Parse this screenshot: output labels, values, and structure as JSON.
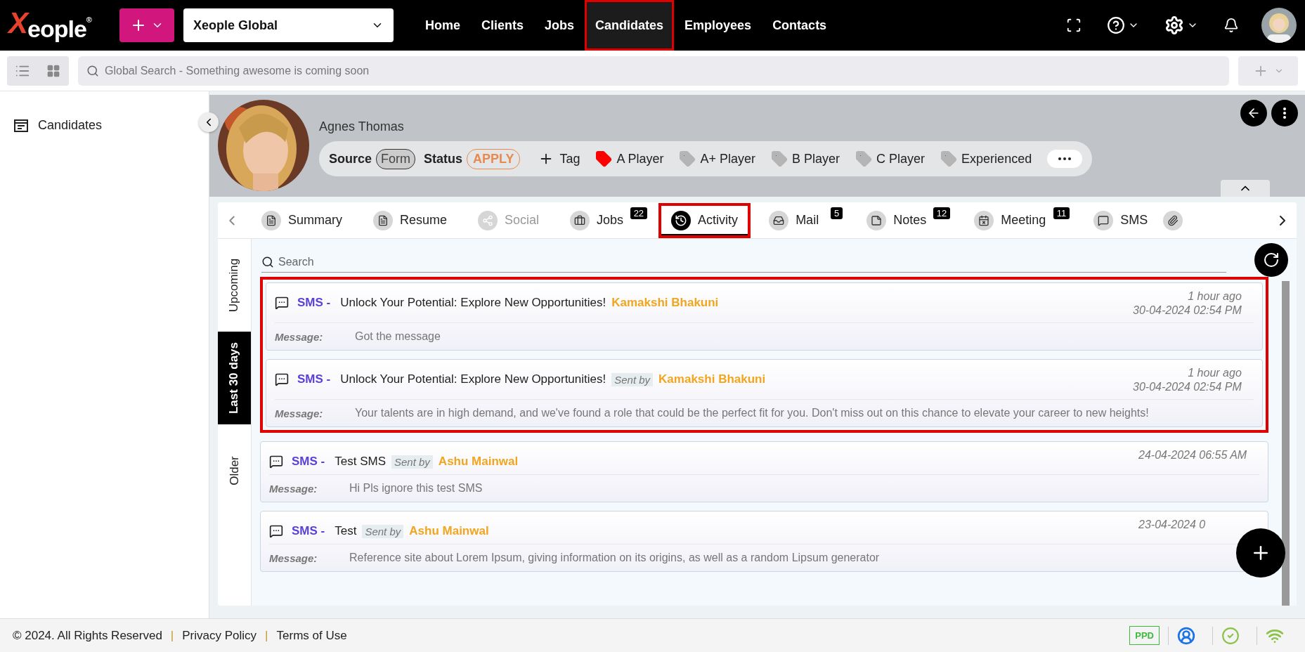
{
  "logo": {
    "text": "Xeople",
    "mark": "®"
  },
  "workspace": "Xeople Global",
  "nav": [
    {
      "label": "Home",
      "selected": false,
      "annotated": false
    },
    {
      "label": "Clients",
      "selected": false,
      "annotated": false
    },
    {
      "label": "Jobs",
      "selected": false,
      "annotated": false
    },
    {
      "label": "Candidates",
      "selected": true,
      "annotated": true
    },
    {
      "label": "Employees",
      "selected": false,
      "annotated": false
    },
    {
      "label": "Contacts",
      "selected": false,
      "annotated": false
    }
  ],
  "global_search": {
    "placeholder": "Global Search - Something awesome is coming soon"
  },
  "sidebar": {
    "items": [
      {
        "label": "Candidates"
      }
    ]
  },
  "candidate": {
    "name": "Agnes Thomas",
    "source_label": "Source",
    "source": "Form",
    "status_label": "Status",
    "status": "APPLY",
    "add_tag": "Tag",
    "tags": [
      {
        "label": "A Player",
        "color": "#ff0000"
      },
      {
        "label": "A+ Player",
        "color": "#b5b5b5"
      },
      {
        "label": "B Player",
        "color": "#b5b5b5"
      },
      {
        "label": "C Player",
        "color": "#b5b5b5"
      },
      {
        "label": "Experienced",
        "color": "#b5b5b5"
      }
    ]
  },
  "tabs": [
    {
      "kind": "summary",
      "label": "Summary",
      "selected": false,
      "disabled": false,
      "annotated": false
    },
    {
      "kind": "resume",
      "label": "Resume",
      "selected": false,
      "disabled": false,
      "annotated": false
    },
    {
      "kind": "social",
      "label": "Social",
      "selected": false,
      "disabled": true,
      "annotated": false
    },
    {
      "kind": "jobs",
      "label": "Jobs",
      "count": "22",
      "selected": false,
      "disabled": false,
      "annotated": false
    },
    {
      "kind": "activity",
      "label": "Activity",
      "selected": true,
      "disabled": false,
      "annotated": true
    },
    {
      "kind": "mail",
      "label": "Mail",
      "count": "5",
      "selected": false,
      "disabled": false,
      "annotated": false
    },
    {
      "kind": "notes",
      "label": "Notes",
      "count": "12",
      "selected": false,
      "disabled": false,
      "annotated": false
    },
    {
      "kind": "meeting",
      "label": "Meeting",
      "count": "11",
      "selected": false,
      "disabled": false,
      "annotated": false
    },
    {
      "kind": "sms",
      "label": "SMS",
      "selected": false,
      "disabled": false,
      "annotated": false
    }
  ],
  "periods": [
    {
      "label": "Upcoming",
      "selected": false
    },
    {
      "label": "Last 30 days",
      "selected": true
    },
    {
      "label": "Older",
      "selected": false
    }
  ],
  "activity_search": {
    "placeholder": "Search"
  },
  "activities": [
    {
      "type": "SMS -",
      "subject": "Unlock Your Potential: Explore New Opportunities!",
      "author": "Kamakshi Bhakuni",
      "time_ago": "1 hour ago",
      "date": "30-04-2024 02:54 PM",
      "message_label": "Message:",
      "message": "Got the message",
      "annotated": true
    },
    {
      "type": "SMS -",
      "subject": "Unlock Your Potential: Explore New Opportunities!",
      "sent_by": "Sent by",
      "author": "Kamakshi Bhakuni",
      "time_ago": "1 hour ago",
      "date": "30-04-2024 02:54 PM",
      "message_label": "Message:",
      "message": "Your talents are in high demand, and we've found a role that could be the perfect fit for you. Don't miss out on this chance to elevate your career to new heights!",
      "annotated": true
    },
    {
      "type": "SMS -",
      "subject": "Test SMS",
      "sent_by": "Sent by",
      "author": "Ashu Mainwal",
      "date": "24-04-2024 06:55 AM",
      "message_label": "Message:",
      "message": "Hi Pls ignore this test SMS",
      "annotated": false
    },
    {
      "type": "SMS -",
      "subject": "Test",
      "sent_by": "Sent by",
      "author": "Ashu Mainwal",
      "date": "23-04-2024 0",
      "message_label": "Message:",
      "message": "Reference site about Lorem Ipsum, giving information on its origins, as well as a random Lipsum generator",
      "annotated": false
    }
  ],
  "footer": {
    "copyright": "© 2024. All Rights Reserved",
    "separator": "|",
    "links": [
      "Privacy Policy",
      "Terms of Use"
    ],
    "badge": "PPD"
  }
}
